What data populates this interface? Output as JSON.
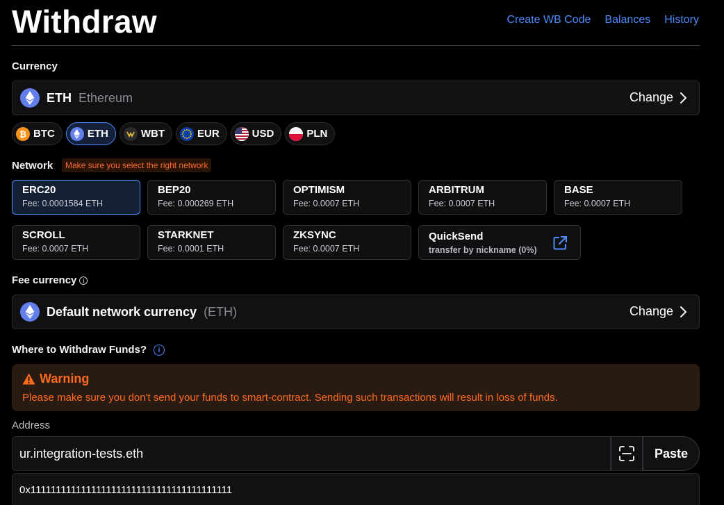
{
  "header": {
    "title": "Withdraw",
    "links": [
      "Create WB Code",
      "Balances",
      "History"
    ]
  },
  "currency": {
    "label": "Currency",
    "selected_symbol": "ETH",
    "selected_name": "Ethereum",
    "change_label": "Change",
    "quick_picks": [
      {
        "symbol": "BTC",
        "icon": "bitcoin-icon",
        "color": "#f7931a"
      },
      {
        "symbol": "ETH",
        "icon": "ethereum-icon",
        "color": "#627eea",
        "active": true
      },
      {
        "symbol": "WBT",
        "icon": "whitebit-icon",
        "color": "#2b2b2b"
      },
      {
        "symbol": "EUR",
        "icon": "eu-flag-icon",
        "color": "#0a3ea8"
      },
      {
        "symbol": "USD",
        "icon": "us-flag-icon",
        "color": "#b22234"
      },
      {
        "symbol": "PLN",
        "icon": "pl-flag-icon",
        "color": "#dc143c"
      }
    ]
  },
  "network": {
    "label": "Network",
    "hint": "Make sure you select the right network",
    "options": [
      {
        "name": "ERC20",
        "fee": "Fee: 0.0001584 ETH",
        "active": true
      },
      {
        "name": "BEP20",
        "fee": "Fee: 0.000269 ETH"
      },
      {
        "name": "OPTIMISM",
        "fee": "Fee: 0.0007 ETH"
      },
      {
        "name": "ARBITRUM",
        "fee": "Fee: 0.0007 ETH"
      },
      {
        "name": "BASE",
        "fee": "Fee: 0.0007 ETH"
      },
      {
        "name": "SCROLL",
        "fee": "Fee: 0.0007 ETH"
      },
      {
        "name": "STARKNET",
        "fee": "Fee: 0.0001 ETH"
      },
      {
        "name": "ZKSYNC",
        "fee": "Fee: 0.0007 ETH"
      }
    ],
    "quicksend": {
      "name": "QuickSend",
      "desc": "transfer by nickname (0%)"
    }
  },
  "fee_currency": {
    "label": "Fee currency",
    "value": "Default network currency",
    "suffix": "(ETH)",
    "change_label": "Change"
  },
  "withdraw_to": {
    "label": "Where to Withdraw Funds?"
  },
  "warning": {
    "title": "Warning",
    "text": "Please make sure you don't send your funds to smart-contract. Sending such transactions will result in loss of funds."
  },
  "address": {
    "label": "Address",
    "value": "ur.integration-tests.eth",
    "paste_label": "Paste",
    "resolved": "0x1111111111111111111111111111111111111111"
  },
  "colors": {
    "accent": "#4d8dff",
    "warning": "#ff6a1e",
    "background": "#000000"
  }
}
